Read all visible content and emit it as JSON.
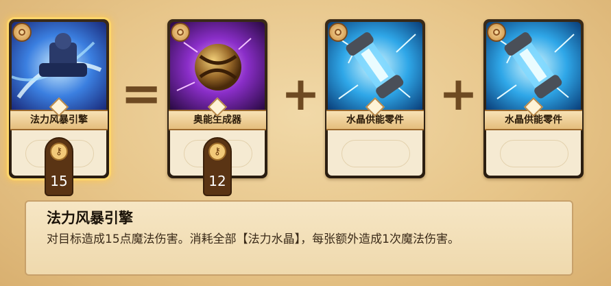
{
  "cards": [
    {
      "name": "法力风暴引擎",
      "cost": "15",
      "selected": true,
      "art_icon": "mage-warrior-art"
    },
    {
      "name": "奥能生成器",
      "cost": "12",
      "selected": false,
      "art_icon": "arcane-orb-art"
    },
    {
      "name": "水晶供能零件",
      "cost": null,
      "selected": false,
      "art_icon": "crystal-capsule-art"
    },
    {
      "name": "水晶供能零件",
      "cost": null,
      "selected": false,
      "art_icon": "crystal-capsule-art"
    }
  ],
  "operators": [
    "=",
    "+",
    "+"
  ],
  "description": {
    "title": "法力风暴引擎",
    "text": "对目标造成15点魔法伤害。消耗全部【法力水晶】，每张额外造成1次魔法伤害。"
  },
  "colors": {
    "selected_glow": "#ffd66b",
    "operator": "#6e4a22",
    "panel_bg": "#f6e6c4"
  }
}
